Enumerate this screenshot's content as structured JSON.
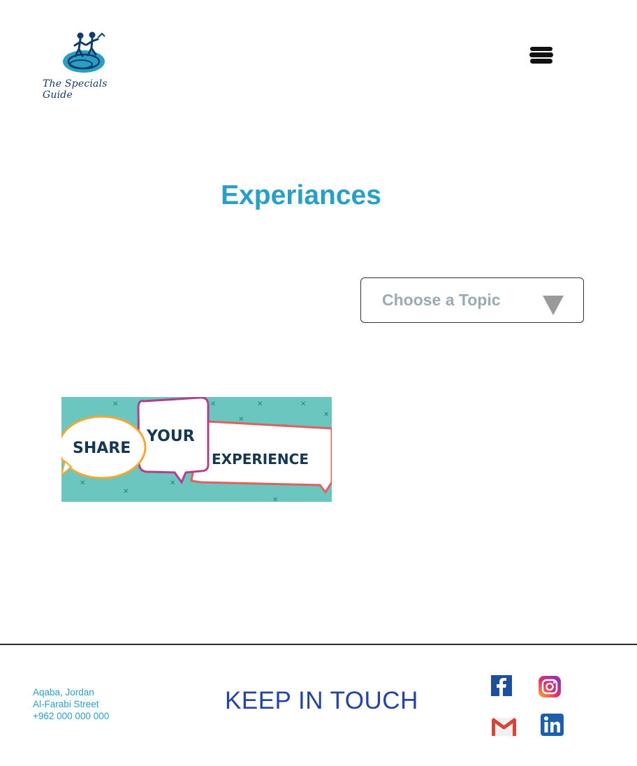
{
  "brand": {
    "name": "The Specials Guide"
  },
  "header": {
    "menu_icon": "hamburger-menu-icon"
  },
  "main": {
    "title": "Experiances",
    "topic_select": {
      "label": "Choose a Topic",
      "icon": "triangle-down-icon"
    },
    "banner": {
      "words": [
        "SHARE",
        "YOUR",
        "EXPERIENCE"
      ]
    }
  },
  "footer": {
    "address": [
      "Aqaba, Jordan",
      "Al-Farabi Street",
      "+962 000 000 000"
    ],
    "heading": "KEEP IN TOUCH",
    "social": [
      {
        "name": "facebook-icon"
      },
      {
        "name": "instagram-icon"
      },
      {
        "name": "gmail-icon"
      },
      {
        "name": "linkedin-icon"
      }
    ]
  },
  "colors": {
    "accent": "#2a9fc4",
    "heading_blue": "#2344a0",
    "placeholder_gray": "#9aabb2",
    "banner_teal": "#6cc6c0"
  }
}
